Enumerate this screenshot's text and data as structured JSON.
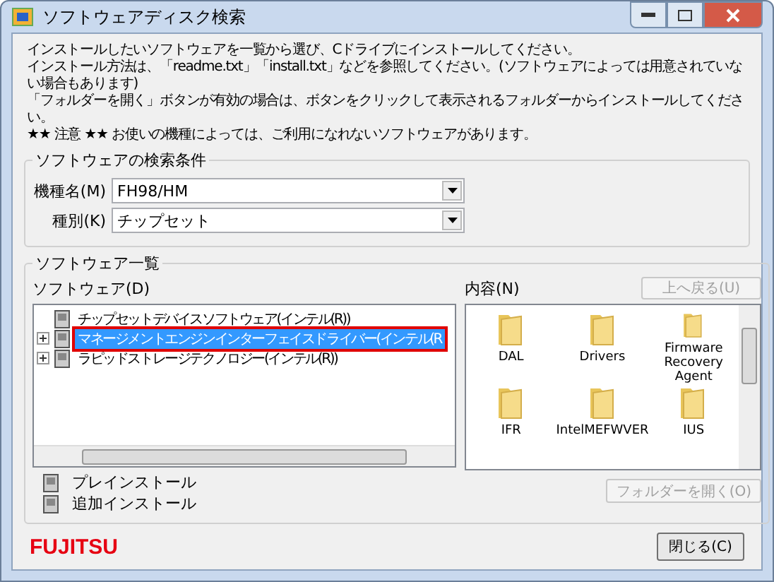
{
  "window": {
    "title": "ソフトウェアディスク検索"
  },
  "instructions": [
    "インストールしたいソフトウェアを一覧から選び、Cドライブにインストールしてください。",
    "インストール方法は、「readme.txt」「install.txt」などを参照してください。(ソフトウェアによっては用意されていない場合もあります)",
    "「フォルダーを開く」ボタンが有効の場合は、ボタンをクリックして表示されるフォルダーからインストールしてください。",
    "★★ 注意 ★★ お使いの機種によっては、ご利用になれないソフトウェアがあります。"
  ],
  "search": {
    "title": "ソフトウェアの検索条件",
    "fields": [
      {
        "label": "機種名(M)",
        "value": "FH98/HM"
      },
      {
        "label": "種別(K)",
        "value": "チップセット"
      }
    ]
  },
  "list": {
    "title": "ソフトウェア一覧",
    "tree_label": "ソフトウェア(D)",
    "tree": [
      {
        "label": "チップセットデバイスソフトウェア(インテル(R))",
        "expandable": false,
        "selected": false
      },
      {
        "label": "マネージメントエンジンインターフェイスドライバー(インテル(R",
        "expandable": true,
        "selected": true
      },
      {
        "label": "ラピッドストレージテクノロジー(インテル(R))",
        "expandable": true,
        "selected": false
      }
    ],
    "contents_label": "内容(N)",
    "up_button": {
      "label": "上へ戻る(U)",
      "disabled": true
    },
    "folders": [
      {
        "name": "DAL"
      },
      {
        "name": "Drivers"
      },
      {
        "name": "Firmware Recovery Agent"
      },
      {
        "name": "IFR"
      },
      {
        "name": "IntelMEFWVER"
      },
      {
        "name": "IUS"
      }
    ],
    "open_button": {
      "label": "フォルダーを開く(O)",
      "disabled": true
    },
    "legend": [
      "プレインストール",
      "追加インストール"
    ]
  },
  "footer": {
    "logo": "FUJITSU",
    "close_button": {
      "label": "閉じる(C)",
      "disabled": false
    }
  }
}
